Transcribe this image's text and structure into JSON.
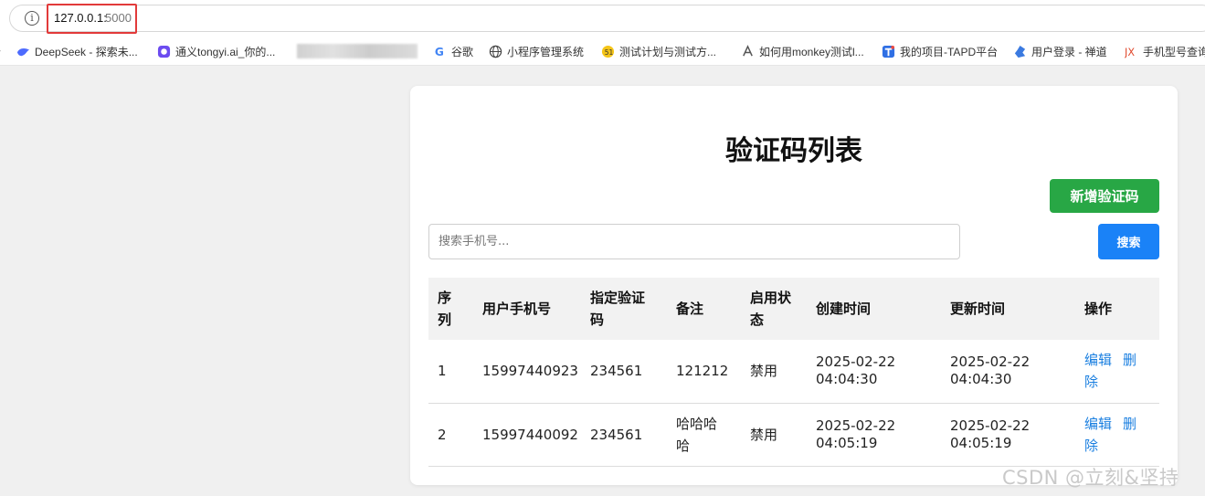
{
  "browser": {
    "url_host": "127.0.0.1:",
    "url_port": "5000",
    "bookmarks": [
      {
        "label": "DeepSeek - 探索未...",
        "icon": "deepseek-icon"
      },
      {
        "label": "通义tongyi.ai_你的...",
        "icon": "tongyi-icon"
      },
      {
        "label": "谷歌",
        "icon": "google-icon"
      },
      {
        "label": "小程序管理系统",
        "icon": "globe-icon"
      },
      {
        "label": "测试计划与测试方...",
        "icon": "yellow-badge-icon"
      },
      {
        "label": "如何用monkey测试l...",
        "icon": "monkey-icon"
      },
      {
        "label": "我的项目-TAPD平台",
        "icon": "tapd-icon"
      },
      {
        "label": "用户登录 - 禅道",
        "icon": "zentao-icon"
      },
      {
        "label": "手机型号查询",
        "icon": "jx-icon"
      }
    ]
  },
  "page": {
    "title": "验证码列表",
    "add_button": "新增验证码",
    "search_placeholder": "搜索手机号...",
    "search_button": "搜索"
  },
  "table": {
    "headers": [
      "序列",
      "用户手机号",
      "指定验证码",
      "备注",
      "启用状态",
      "创建时间",
      "更新时间",
      "操作"
    ],
    "rows": [
      {
        "index": "1",
        "phone": "15997440923",
        "code": "234561",
        "note": "121212",
        "status": "禁用",
        "created": "2025-02-22 04:04:30",
        "updated": "2025-02-22 04:04:30"
      },
      {
        "index": "2",
        "phone": "15997440092",
        "code": "234561",
        "note": "哈哈哈哈",
        "status": "禁用",
        "created": "2025-02-22 04:05:19",
        "updated": "2025-02-22 04:05:19"
      }
    ],
    "edit_label": "编辑",
    "delete_label": "删除"
  },
  "watermark": "CSDN @立刻&坚持",
  "colors": {
    "add_button": "#28a745",
    "search_button": "#1a82f7",
    "link": "#1a7fe0",
    "url_highlight": "#e23a3a"
  }
}
